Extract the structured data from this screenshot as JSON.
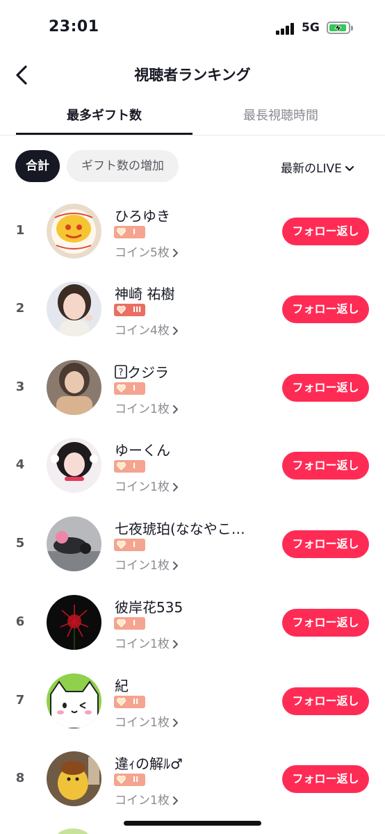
{
  "status_bar": {
    "time": "23:01",
    "network": "5G"
  },
  "nav": {
    "title": "視聴者ランキング"
  },
  "tabs": [
    {
      "label": "最多ギフト数",
      "active": true
    },
    {
      "label": "最長視聴時間",
      "active": false
    }
  ],
  "filters": {
    "chip_total": "合計",
    "chip_increase": "ギフト数の増加",
    "sort_label": "最新のLIVE"
  },
  "colors": {
    "accent": "#fe2c55",
    "badge": "#f4a48f",
    "badge_high": "#e86f62"
  },
  "viewers": [
    {
      "rank": "1",
      "name": "ひろゆき",
      "level": "I",
      "coins": "コイン5枚",
      "button": "フォロー返し",
      "avatar": "cake-photo"
    },
    {
      "rank": "2",
      "name": "神崎 祐樹",
      "level": "III",
      "coins": "コイン4枚",
      "button": "フォロー返し",
      "avatar": "selfie-photo"
    },
    {
      "rank": "3",
      "name": "クジラ",
      "level": "I",
      "coins": "コイン1枚",
      "button": "フォロー返し",
      "avatar": "portrait-photo",
      "name_prefix_icon": "question-box-icon"
    },
    {
      "rank": "4",
      "name": "ゆーくん",
      "level": "I",
      "coins": "コイン1枚",
      "button": "フォロー返し",
      "avatar": "portrait-photo"
    },
    {
      "rank": "5",
      "name": "七夜琥珀(ななやこ…",
      "level": "I",
      "coins": "コイン1枚",
      "button": "フォロー返し",
      "avatar": "motorcycle-photo"
    },
    {
      "rank": "6",
      "name": "彼岸花535",
      "level": "I",
      "coins": "コイン1枚",
      "button": "フォロー返し",
      "avatar": "red-flower-photo"
    },
    {
      "rank": "7",
      "name": "紀",
      "level": "II",
      "coins": "コイン1枚",
      "button": "フォロー返し",
      "avatar": "cat-illustration"
    },
    {
      "rank": "8",
      "name": "違ｨの解ﾙ♂",
      "level": "II",
      "coins": "コイン1枚",
      "button": "フォロー返し",
      "avatar": "plush-toy-photo"
    }
  ]
}
